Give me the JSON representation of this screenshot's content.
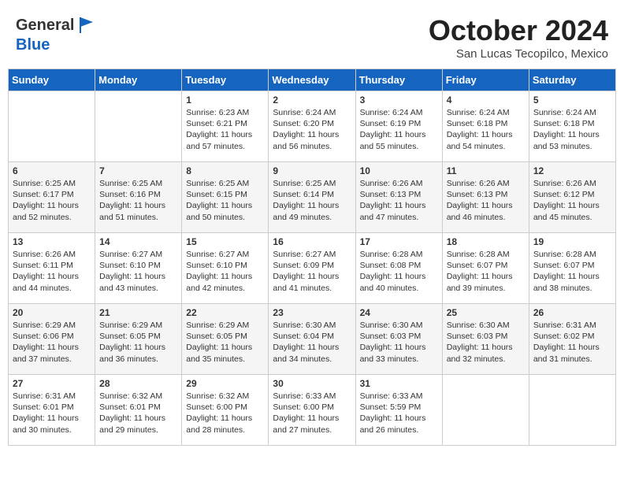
{
  "header": {
    "logo_line1": "General",
    "logo_line2": "Blue",
    "month": "October 2024",
    "location": "San Lucas Tecopilco, Mexico"
  },
  "days_of_week": [
    "Sunday",
    "Monday",
    "Tuesday",
    "Wednesday",
    "Thursday",
    "Friday",
    "Saturday"
  ],
  "weeks": [
    [
      {
        "day": "",
        "sunrise": "",
        "sunset": "",
        "daylight": ""
      },
      {
        "day": "",
        "sunrise": "",
        "sunset": "",
        "daylight": ""
      },
      {
        "day": "1",
        "sunrise": "Sunrise: 6:23 AM",
        "sunset": "Sunset: 6:21 PM",
        "daylight": "Daylight: 11 hours and 57 minutes."
      },
      {
        "day": "2",
        "sunrise": "Sunrise: 6:24 AM",
        "sunset": "Sunset: 6:20 PM",
        "daylight": "Daylight: 11 hours and 56 minutes."
      },
      {
        "day": "3",
        "sunrise": "Sunrise: 6:24 AM",
        "sunset": "Sunset: 6:19 PM",
        "daylight": "Daylight: 11 hours and 55 minutes."
      },
      {
        "day": "4",
        "sunrise": "Sunrise: 6:24 AM",
        "sunset": "Sunset: 6:18 PM",
        "daylight": "Daylight: 11 hours and 54 minutes."
      },
      {
        "day": "5",
        "sunrise": "Sunrise: 6:24 AM",
        "sunset": "Sunset: 6:18 PM",
        "daylight": "Daylight: 11 hours and 53 minutes."
      }
    ],
    [
      {
        "day": "6",
        "sunrise": "Sunrise: 6:25 AM",
        "sunset": "Sunset: 6:17 PM",
        "daylight": "Daylight: 11 hours and 52 minutes."
      },
      {
        "day": "7",
        "sunrise": "Sunrise: 6:25 AM",
        "sunset": "Sunset: 6:16 PM",
        "daylight": "Daylight: 11 hours and 51 minutes."
      },
      {
        "day": "8",
        "sunrise": "Sunrise: 6:25 AM",
        "sunset": "Sunset: 6:15 PM",
        "daylight": "Daylight: 11 hours and 50 minutes."
      },
      {
        "day": "9",
        "sunrise": "Sunrise: 6:25 AM",
        "sunset": "Sunset: 6:14 PM",
        "daylight": "Daylight: 11 hours and 49 minutes."
      },
      {
        "day": "10",
        "sunrise": "Sunrise: 6:26 AM",
        "sunset": "Sunset: 6:13 PM",
        "daylight": "Daylight: 11 hours and 47 minutes."
      },
      {
        "day": "11",
        "sunrise": "Sunrise: 6:26 AM",
        "sunset": "Sunset: 6:13 PM",
        "daylight": "Daylight: 11 hours and 46 minutes."
      },
      {
        "day": "12",
        "sunrise": "Sunrise: 6:26 AM",
        "sunset": "Sunset: 6:12 PM",
        "daylight": "Daylight: 11 hours and 45 minutes."
      }
    ],
    [
      {
        "day": "13",
        "sunrise": "Sunrise: 6:26 AM",
        "sunset": "Sunset: 6:11 PM",
        "daylight": "Daylight: 11 hours and 44 minutes."
      },
      {
        "day": "14",
        "sunrise": "Sunrise: 6:27 AM",
        "sunset": "Sunset: 6:10 PM",
        "daylight": "Daylight: 11 hours and 43 minutes."
      },
      {
        "day": "15",
        "sunrise": "Sunrise: 6:27 AM",
        "sunset": "Sunset: 6:10 PM",
        "daylight": "Daylight: 11 hours and 42 minutes."
      },
      {
        "day": "16",
        "sunrise": "Sunrise: 6:27 AM",
        "sunset": "Sunset: 6:09 PM",
        "daylight": "Daylight: 11 hours and 41 minutes."
      },
      {
        "day": "17",
        "sunrise": "Sunrise: 6:28 AM",
        "sunset": "Sunset: 6:08 PM",
        "daylight": "Daylight: 11 hours and 40 minutes."
      },
      {
        "day": "18",
        "sunrise": "Sunrise: 6:28 AM",
        "sunset": "Sunset: 6:07 PM",
        "daylight": "Daylight: 11 hours and 39 minutes."
      },
      {
        "day": "19",
        "sunrise": "Sunrise: 6:28 AM",
        "sunset": "Sunset: 6:07 PM",
        "daylight": "Daylight: 11 hours and 38 minutes."
      }
    ],
    [
      {
        "day": "20",
        "sunrise": "Sunrise: 6:29 AM",
        "sunset": "Sunset: 6:06 PM",
        "daylight": "Daylight: 11 hours and 37 minutes."
      },
      {
        "day": "21",
        "sunrise": "Sunrise: 6:29 AM",
        "sunset": "Sunset: 6:05 PM",
        "daylight": "Daylight: 11 hours and 36 minutes."
      },
      {
        "day": "22",
        "sunrise": "Sunrise: 6:29 AM",
        "sunset": "Sunset: 6:05 PM",
        "daylight": "Daylight: 11 hours and 35 minutes."
      },
      {
        "day": "23",
        "sunrise": "Sunrise: 6:30 AM",
        "sunset": "Sunset: 6:04 PM",
        "daylight": "Daylight: 11 hours and 34 minutes."
      },
      {
        "day": "24",
        "sunrise": "Sunrise: 6:30 AM",
        "sunset": "Sunset: 6:03 PM",
        "daylight": "Daylight: 11 hours and 33 minutes."
      },
      {
        "day": "25",
        "sunrise": "Sunrise: 6:30 AM",
        "sunset": "Sunset: 6:03 PM",
        "daylight": "Daylight: 11 hours and 32 minutes."
      },
      {
        "day": "26",
        "sunrise": "Sunrise: 6:31 AM",
        "sunset": "Sunset: 6:02 PM",
        "daylight": "Daylight: 11 hours and 31 minutes."
      }
    ],
    [
      {
        "day": "27",
        "sunrise": "Sunrise: 6:31 AM",
        "sunset": "Sunset: 6:01 PM",
        "daylight": "Daylight: 11 hours and 30 minutes."
      },
      {
        "day": "28",
        "sunrise": "Sunrise: 6:32 AM",
        "sunset": "Sunset: 6:01 PM",
        "daylight": "Daylight: 11 hours and 29 minutes."
      },
      {
        "day": "29",
        "sunrise": "Sunrise: 6:32 AM",
        "sunset": "Sunset: 6:00 PM",
        "daylight": "Daylight: 11 hours and 28 minutes."
      },
      {
        "day": "30",
        "sunrise": "Sunrise: 6:33 AM",
        "sunset": "Sunset: 6:00 PM",
        "daylight": "Daylight: 11 hours and 27 minutes."
      },
      {
        "day": "31",
        "sunrise": "Sunrise: 6:33 AM",
        "sunset": "Sunset: 5:59 PM",
        "daylight": "Daylight: 11 hours and 26 minutes."
      },
      {
        "day": "",
        "sunrise": "",
        "sunset": "",
        "daylight": ""
      },
      {
        "day": "",
        "sunrise": "",
        "sunset": "",
        "daylight": ""
      }
    ]
  ]
}
